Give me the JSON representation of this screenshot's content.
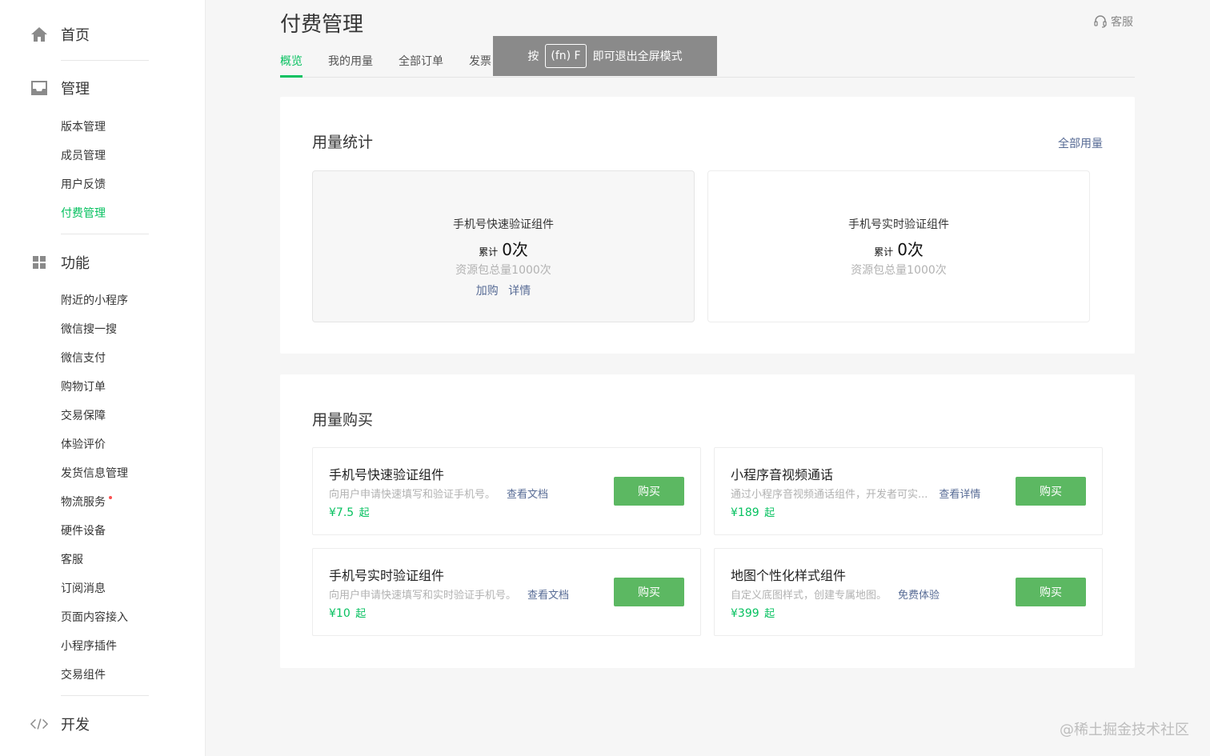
{
  "sidebar": {
    "home": "首页",
    "manage": {
      "title": "管理",
      "items": [
        "版本管理",
        "成员管理",
        "用户反馈",
        "付费管理"
      ]
    },
    "features": {
      "title": "功能",
      "items": [
        "附近的小程序",
        "微信搜一搜",
        "微信支付",
        "购物订单",
        "交易保障",
        "体验评价",
        "发货信息管理",
        "物流服务",
        "硬件设备",
        "客服",
        "订阅消息",
        "页面内容接入",
        "小程序插件",
        "交易组件"
      ]
    },
    "dev": "开发"
  },
  "header": {
    "title": "付费管理",
    "service": "客服",
    "tabs": [
      "概览",
      "我的用量",
      "全部订单",
      "发票"
    ]
  },
  "toast": {
    "prefix": "按",
    "key": "(fn) F",
    "suffix": "即可退出全屏模式"
  },
  "usage": {
    "title": "用量统计",
    "all_link": "全部用量",
    "cards": [
      {
        "name": "手机号快速验证组件",
        "count_label": "累计",
        "count_value": "0次",
        "total": "资源包总量1000次",
        "link_buy": "加购",
        "link_detail": "详情"
      },
      {
        "name": "手机号实时验证组件",
        "count_label": "累计",
        "count_value": "0次",
        "total": "资源包总量1000次"
      }
    ]
  },
  "purchase": {
    "title": "用量购买",
    "items": [
      {
        "name": "手机号快速验证组件",
        "desc": "向用户申请快速填写和验证手机号。",
        "link": "查看文档",
        "price": "¥7.5",
        "unit": "起",
        "button": "购买"
      },
      {
        "name": "小程序音视频通话",
        "desc": "通过小程序音视频通话组件，开发者可实...",
        "link": "查看详情",
        "price": "¥189",
        "unit": "起",
        "button": "购买"
      },
      {
        "name": "手机号实时验证组件",
        "desc": "向用户申请快速填写和实时验证手机号。",
        "link": "查看文档",
        "price": "¥10",
        "unit": "起",
        "button": "购买"
      },
      {
        "name": "地图个性化样式组件",
        "desc": "自定义底图样式，创建专属地图。",
        "link": "免费体验",
        "price": "¥399",
        "unit": "起",
        "button": "购买"
      }
    ]
  },
  "watermark": "@稀土掘金技术社区",
  "colors": {
    "accent": "#07c160",
    "link": "#576b95",
    "button": "#5cb862"
  }
}
